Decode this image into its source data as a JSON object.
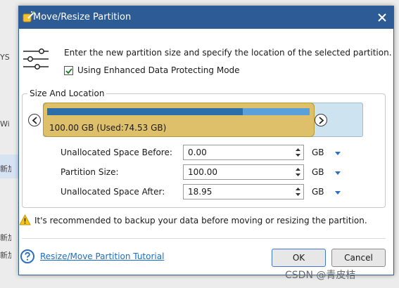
{
  "background": {
    "fragments": [
      "YS",
      "Wi",
      "新加",
      "新加",
      "新加"
    ]
  },
  "dialog": {
    "title": "Move/Resize Partition",
    "icons": {
      "app": "app-wizard-icon",
      "close": "close-icon",
      "settings": "sliders-icon",
      "warning": "warning-icon",
      "help": "help-icon"
    },
    "instruction": "Enter the new partition size and specify the location of the selected partition.",
    "enhanced_mode_label": "Using Enhanced Data Protecting Mode",
    "enhanced_mode_checked": true,
    "group_title": "Size And Location",
    "partition": {
      "size_label": "100.00 GB (Used:74.53 GB)",
      "used_fraction": 0.7453,
      "colors": {
        "block": "#dec06b",
        "used": "#2b6ea9",
        "free": "#5aa0dc",
        "unallocated": "#cde3ef"
      }
    },
    "fields": [
      {
        "label": "Unallocated Space Before:",
        "value": "0.00",
        "unit": "GB"
      },
      {
        "label": "Partition Size:",
        "value": "100.00",
        "unit": "GB"
      },
      {
        "label": "Unallocated Space After:",
        "value": "18.95",
        "unit": "GB"
      }
    ],
    "warning": "It's recommended to backup your data before moving or resizing the partition.",
    "help_link": "Resize/Move Partition Tutorial",
    "ok_label": "OK",
    "cancel_label": "Cancel"
  },
  "watermark": "CSDN @青皮桔"
}
